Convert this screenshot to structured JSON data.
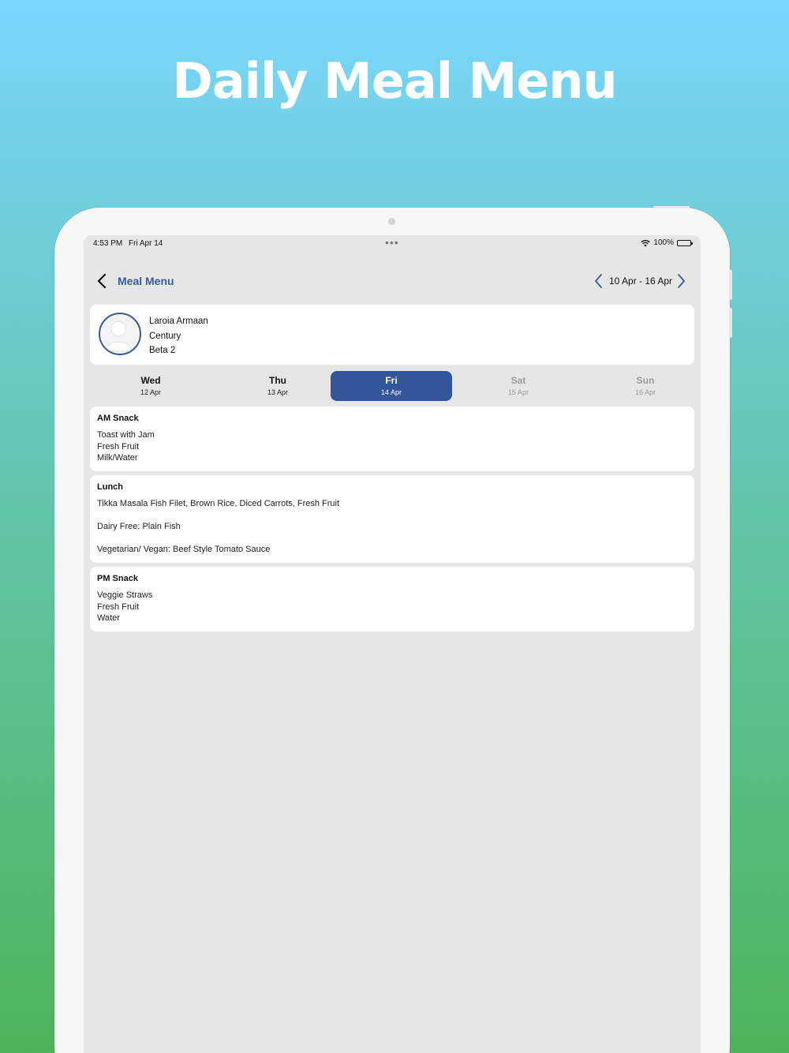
{
  "promo": {
    "title": "Daily Meal Menu"
  },
  "status_bar": {
    "time": "4:53 PM",
    "date": "Fri Apr 14",
    "battery": "100%",
    "battery_level": 1.0
  },
  "nav": {
    "title": "Meal Menu",
    "week_range": "10 Apr - 16 Apr",
    "back_icon": "chevron-left-icon",
    "prev_icon": "chevron-left-icon",
    "next_icon": "chevron-right-icon"
  },
  "profile": {
    "name": "Laroia Armaan",
    "school": "Century",
    "class": "Beta 2",
    "avatar_icon": "person-avatar-icon"
  },
  "days": [
    {
      "name": "Wed",
      "date": "12 Apr",
      "state": "normal"
    },
    {
      "name": "Thu",
      "date": "13 Apr",
      "state": "normal"
    },
    {
      "name": "Fri",
      "date": "14 Apr",
      "state": "active"
    },
    {
      "name": "Sat",
      "date": "15 Apr",
      "state": "muted"
    },
    {
      "name": "Sun",
      "date": "16 Apr",
      "state": "muted"
    }
  ],
  "meals": [
    {
      "title": "AM Snack",
      "lines": [
        "Toast with Jam",
        "Fresh Fruit",
        "Milk/Water"
      ]
    },
    {
      "title": "Lunch",
      "lines": [
        "Tikka Masala Fish Filet, Brown Rice, Diced Carrots, Fresh Fruit",
        "",
        "Dairy Free: Plain Fish",
        "",
        "Vegetarian/ Vegan: Beef Style Tomato Sauce"
      ]
    },
    {
      "title": "PM Snack",
      "lines": [
        "Veggie Straws",
        "Fresh Fruit",
        "Water"
      ]
    }
  ],
  "colors": {
    "accent": "#33569a",
    "nav_title": "#3a5a9c",
    "screen_bg": "#e6e6e6",
    "card_bg": "#ffffff"
  }
}
